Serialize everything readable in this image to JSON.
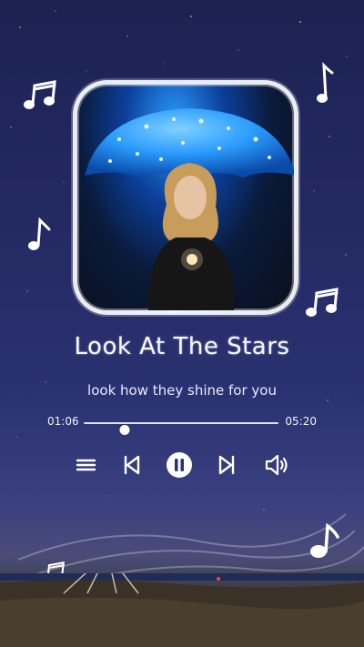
{
  "song": {
    "title": "Look At The Stars",
    "lyric": "look how they shine for you"
  },
  "playback": {
    "current_time": "01:06",
    "total_time": "05:20",
    "progress_fraction": 0.21
  },
  "icons": {
    "shuffle": "shuffle-icon",
    "previous": "skip-previous-icon",
    "play_pause": "pause-icon",
    "next": "skip-next-icon",
    "volume": "volume-icon"
  },
  "colors": {
    "background_top": "#1c2251",
    "accent": "#ffffff",
    "umbrella_blue": "#2b9cff"
  }
}
